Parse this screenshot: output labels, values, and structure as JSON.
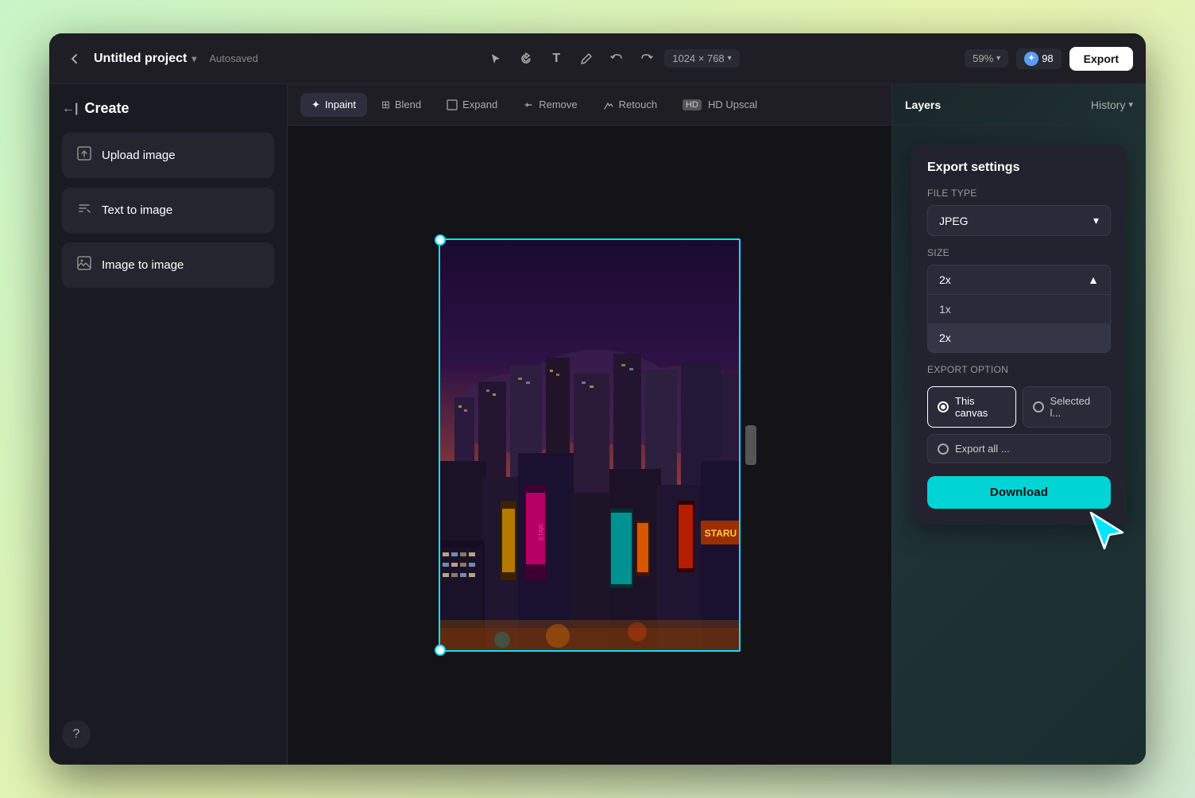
{
  "window": {
    "title": "Untitled project"
  },
  "topbar": {
    "back_icon": "←",
    "project_name": "Untitled project",
    "project_dropdown_icon": "▾",
    "autosaved": "Autosaved",
    "canvas_size": "1024 × 768",
    "canvas_size_dropdown": "▾",
    "zoom": "59%",
    "zoom_dropdown": "▾",
    "credits": "98",
    "export_label": "Export",
    "tools": [
      {
        "name": "select",
        "icon": "⬆"
      },
      {
        "name": "rotate",
        "icon": "↻"
      },
      {
        "name": "text",
        "icon": "T"
      },
      {
        "name": "pen",
        "icon": "✏"
      },
      {
        "name": "undo",
        "icon": "↩"
      },
      {
        "name": "redo",
        "icon": "↪"
      }
    ]
  },
  "sidebar": {
    "create_label": "Create",
    "back_icon": "←",
    "buttons": [
      {
        "id": "upload",
        "label": "Upload image",
        "icon": "⬆"
      },
      {
        "id": "text-to-image",
        "label": "Text to image",
        "icon": "⇅"
      },
      {
        "id": "image-to-image",
        "label": "Image to image",
        "icon": "⊡"
      }
    ],
    "help_icon": "?"
  },
  "toolbar": {
    "tabs": [
      {
        "id": "inpaint",
        "label": "Inpaint",
        "active": true,
        "icon": "✦"
      },
      {
        "id": "blend",
        "label": "Blend",
        "active": false,
        "icon": "⊞"
      },
      {
        "id": "expand",
        "label": "Expand",
        "active": false,
        "icon": "⊡"
      },
      {
        "id": "remove",
        "label": "Remove",
        "active": false,
        "icon": "◇"
      },
      {
        "id": "retouch",
        "label": "Retouch",
        "active": false,
        "icon": "✦"
      },
      {
        "id": "upscal",
        "label": "HD Upscal",
        "active": false,
        "icon": ""
      }
    ]
  },
  "right_panel": {
    "layers_tab": "Layers",
    "history_tab": "History",
    "history_dropdown": "▾"
  },
  "export_settings": {
    "title": "Export settings",
    "file_type_label": "File type",
    "file_type_value": "JPEG",
    "file_type_dropdown": "▾",
    "size_label": "Size",
    "size_value": "2x",
    "size_dropdown": "▲",
    "size_options": [
      {
        "label": "1x",
        "selected": false
      },
      {
        "label": "2x",
        "selected": true
      }
    ],
    "export_option_label": "Export option",
    "options": [
      {
        "id": "this-canvas",
        "label": "This canvas",
        "active": true
      },
      {
        "id": "selected",
        "label": "Selected l...",
        "active": false
      }
    ],
    "export_all_label": "Export all ...",
    "download_label": "Download"
  }
}
